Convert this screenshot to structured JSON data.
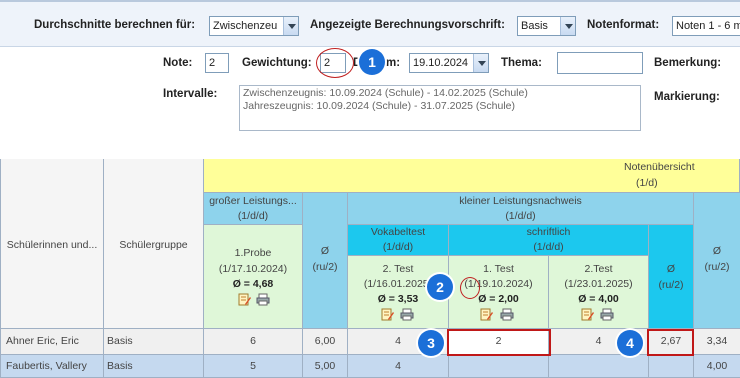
{
  "filters": {
    "average_label": "Durchschnitte berechnen für:",
    "average_value": "Zwischenzeu",
    "rule_label": "Angezeigte Berechnungsvorschrift:",
    "rule_value": "Basis",
    "format_label": "Notenformat:",
    "format_value": "Noten 1 - 6 m"
  },
  "form": {
    "note_label": "Note:",
    "note_value": "2",
    "weight_label": "Gewichtung:",
    "weight_value": "2",
    "date_label": "Datum:",
    "date_label_visible": "D",
    "date_label_tail": "m:",
    "date_value": "19.10.2024",
    "topic_label": "Thema:",
    "topic_value": "",
    "remark_label": "Bemerkung:",
    "marking_label": "Markierung:",
    "intervals_label": "Intervalle:",
    "intervals": [
      "Zwischenzeugnis: 10.09.2024 (Schule) - 14.02.2025 (Schule)",
      "Jahreszeugnis: 10.09.2024 (Schule) - 31.07.2025 (Schule)"
    ]
  },
  "badges": [
    "1",
    "2",
    "3",
    "4"
  ],
  "table": {
    "col_students": "Schülerinnen und...",
    "col_group": "Schülergruppe",
    "overview_title": "Notenübersicht",
    "overview_sub": "(1/d)",
    "big_title": "großer Leistungs...",
    "big_sub": "(1/d/d)",
    "small_title": "kleiner Leistungsnachweis",
    "small_sub": "(1/d/d)",
    "vocab_title": "Vokabeltest",
    "vocab_sub": "(1/d/d)",
    "written_title": "schriftlich",
    "written_sub": "(1/d/d)",
    "avg_symbol": "Ø",
    "avg_sub": "(ru/2)",
    "probe": {
      "name": "1.Probe",
      "meta": "(1/17.10.2024)",
      "avg": "Ø = 4,68"
    },
    "test_vocab": {
      "name": "2. Test",
      "meta": "(1/16.01.2025)",
      "avg": "Ø = 3,53"
    },
    "test_written1": {
      "name": "1. Test",
      "meta": "(1/19.10.2024)",
      "avg": "Ø = 2,00"
    },
    "test_written2": {
      "name": "2.Test",
      "meta": "(1/23.01.2025)",
      "avg": "Ø = 4,00"
    },
    "rows": [
      {
        "name": "Ahner Eric, Eric",
        "group": "Basis",
        "probe": "6",
        "avg_big": "6,00",
        "vocab": "4",
        "written1": "2",
        "written2": "4",
        "avg_written": "2,67",
        "avg_total": "3,34"
      },
      {
        "name": "Faubertis, Vallery",
        "group": "Basis",
        "probe": "5",
        "avg_big": "5,00",
        "vocab": "4",
        "written1": "",
        "written2": "",
        "avg_written": "",
        "avg_total": "4,00"
      }
    ]
  },
  "colors": {
    "accent_badge": "#1b6fd8",
    "annotation_red": "#c01818",
    "header_yellow": "#ffff99",
    "header_green": "#dff7d8",
    "header_cyan": "#8ed3ec"
  }
}
